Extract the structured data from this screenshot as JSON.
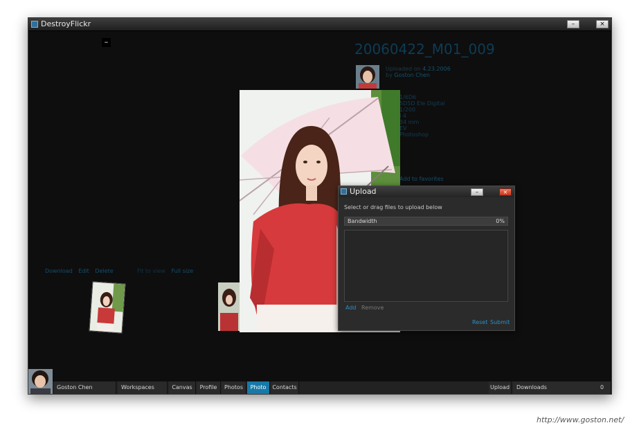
{
  "app": {
    "title": "DestroyFlickr",
    "minimize_glyph": "–",
    "close_glyph": "×"
  },
  "canvas": {
    "collapse_glyph": "–"
  },
  "photo": {
    "title": "20060422_M01_009",
    "uploaded_label": "Uploaded on",
    "uploaded_date": "4.23.2006",
    "by_label": "by",
    "owner": "Goston Chen",
    "exif": [
      "1/6D6",
      "5D5D Ele Digital",
      "1/200",
      "I 4",
      "34 mm",
      "EV",
      "Photoshop"
    ],
    "add_to_favorites": "Add to favorites",
    "actions": [
      "Download",
      "Edit",
      "Delete"
    ],
    "view_label": "Fit to view",
    "full_size": "Full size"
  },
  "upload_dialog": {
    "title": "Upload",
    "minimize_glyph": "–",
    "close_glyph": "×",
    "instruction": "Select or drag files to upload below",
    "bandwidth_label": "Bandwidth",
    "bandwidth_percent": "0%",
    "bandwidth_value": 0,
    "add_label": "Add",
    "remove_label": "Remove",
    "reset_label": "Reset",
    "submit_label": "Submit"
  },
  "taskbar": {
    "user_name": "Goston Chen",
    "tabs": [
      "Workspaces",
      "Canvas",
      "Profile",
      "Photos",
      "Photo",
      "Contacts"
    ],
    "active_tab": "Photo",
    "upload_label": "Upload",
    "downloads_label": "Downloads",
    "downloads_count": "0"
  },
  "watermark": "http://www.goston.net/",
  "colors": {
    "accent": "#1779a8",
    "link": "#2d8fc4",
    "background": "#0e0e0e",
    "close_button": "#c7321b"
  },
  "icons": [
    "app-icon",
    "minimize-icon",
    "close-icon",
    "collapse-icon"
  ]
}
